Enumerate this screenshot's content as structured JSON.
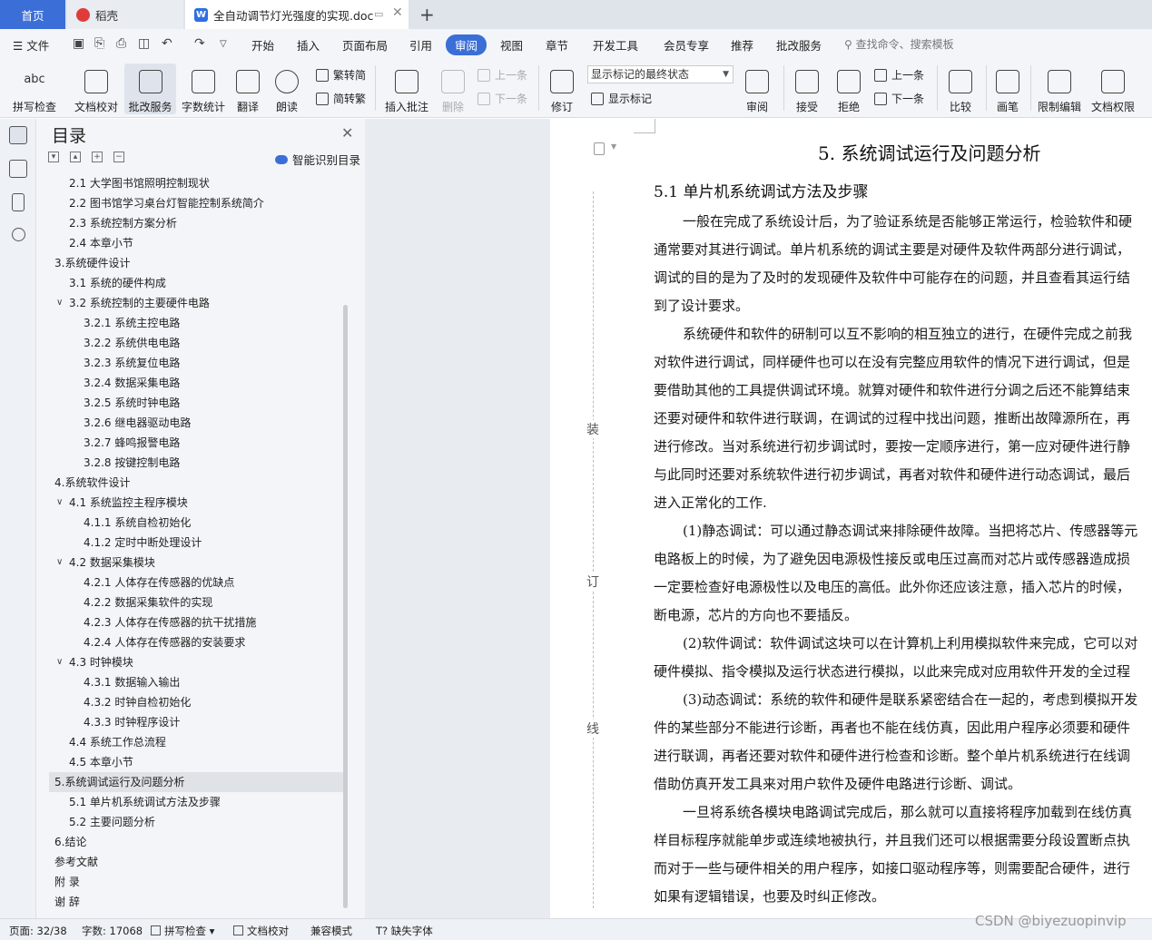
{
  "tabs": {
    "home": "首页",
    "daoke": "稻壳",
    "doc": "全自动调节灯光强度的实现.doc"
  },
  "menu": {
    "file": "文件",
    "items": [
      "开始",
      "插入",
      "页面布局",
      "引用",
      "审阅",
      "视图",
      "章节",
      "开发工具",
      "会员专享",
      "推荐",
      "批改服务"
    ],
    "active": "审阅",
    "search": "查找命令、搜索模板"
  },
  "ribbon": {
    "spell_check": "拼写检查",
    "doc_proof": "文档校对",
    "correction_service": "批改服务",
    "word_count": "字数统计",
    "translate": "翻译",
    "read_aloud": "朗读",
    "trad_to_simp": "繁转简",
    "simp_to_trad": "简转繁",
    "insert_comment": "插入批注",
    "delete": "删除",
    "prev_comment": "上一条",
    "next_comment": "下一条",
    "track_changes": "修订",
    "markup_state": "显示标记的最终状态",
    "show_markup": "显示标记",
    "review": "审阅",
    "accept": "接受",
    "reject": "拒绝",
    "prev": "上一条",
    "next": "下一条",
    "compare": "比较",
    "pen": "画笔",
    "restrict_edit": "限制编辑",
    "doc_permission": "文档权限"
  },
  "toc": {
    "title": "目录",
    "smart": "智能识别目录",
    "items": [
      {
        "text": "2.1  大学图书馆照明控制现状",
        "level": 2
      },
      {
        "text": "2.2  图书馆学习桌台灯智能控制系统简介",
        "level": 2
      },
      {
        "text": "2.3  系统控制方案分析",
        "level": 2
      },
      {
        "text": "2.4  本章小节",
        "level": 2
      },
      {
        "text": "3.系统硬件设计",
        "level": 1,
        "caret": true
      },
      {
        "text": "3.1  系统的硬件构成",
        "level": 2
      },
      {
        "text": "3.2  系统控制的主要硬件电路",
        "level": 2,
        "caret": true
      },
      {
        "text": "3.2.1  系统主控电路",
        "level": 3
      },
      {
        "text": "3.2.2  系统供电电路",
        "level": 3
      },
      {
        "text": "3.2.3  系统复位电路",
        "level": 3
      },
      {
        "text": "3.2.4  数据采集电路",
        "level": 3
      },
      {
        "text": "3.2.5  系统时钟电路",
        "level": 3
      },
      {
        "text": "3.2.6  继电器驱动电路",
        "level": 3
      },
      {
        "text": "3.2.7  蜂鸣报警电路",
        "level": 3
      },
      {
        "text": "3.2.8  按键控制电路",
        "level": 3
      },
      {
        "text": "4.系统软件设计",
        "level": 1,
        "caret": true
      },
      {
        "text": "4.1 系统监控主程序模块",
        "level": 2,
        "caret": true
      },
      {
        "text": "4.1.1  系统自检初始化",
        "level": 3
      },
      {
        "text": "4.1.2  定时中断处理设计",
        "level": 3
      },
      {
        "text": "4.2  数据采集模块",
        "level": 2,
        "caret": true
      },
      {
        "text": "4.2.1  人体存在传感器的优缺点",
        "level": 3
      },
      {
        "text": "4.2.2  数据采集软件的实现",
        "level": 3
      },
      {
        "text": "4.2.3  人体存在传感器的抗干扰措施",
        "level": 3
      },
      {
        "text": "4.2.4  人体存在传感器的安装要求",
        "level": 3
      },
      {
        "text": "4.3  时钟模块",
        "level": 2,
        "caret": true
      },
      {
        "text": "4.3.1  数据输入输出",
        "level": 3
      },
      {
        "text": "4.3.2  时钟自检初始化",
        "level": 3
      },
      {
        "text": "4.3.3  时钟程序设计",
        "level": 3
      },
      {
        "text": "4.4  系统工作总流程",
        "level": 2
      },
      {
        "text": "4.5  本章小节",
        "level": 2
      },
      {
        "text": "5.系统调试运行及问题分析",
        "level": 1,
        "caret": true,
        "selected": true
      },
      {
        "text": "5.1  单片机系统调试方法及步骤",
        "level": 2
      },
      {
        "text": "5.2  主要问题分析",
        "level": 2
      },
      {
        "text": "6.结论",
        "level": 1
      },
      {
        "text": "参考文献",
        "level": 1
      },
      {
        "text": "附    录",
        "level": 1
      },
      {
        "text": "谢    辞",
        "level": 1
      }
    ]
  },
  "document": {
    "binding": [
      "装",
      "订",
      "线"
    ],
    "h1": "5.  系统调试运行及问题分析",
    "h2": "5.1  单片机系统调试方法及步骤",
    "lines": [
      {
        "t": "一般在完成了系统设计后，为了验证系统是否能够正常运行，检验软件和硬",
        "i": true
      },
      {
        "t": "通常要对其进行调试。单片机系统的调试主要是对硬件及软件两部分进行调试，",
        "i": false
      },
      {
        "t": "调试的目的是为了及时的发现硬件及软件中可能存在的问题，并且查看其运行结",
        "i": false
      },
      {
        "t": "到了设计要求。",
        "i": false
      },
      {
        "t": "系统硬件和软件的研制可以互不影响的相互独立的进行，在硬件完成之前我",
        "i": true
      },
      {
        "t": "对软件进行调试，同样硬件也可以在没有完整应用软件的情况下进行调试，但是",
        "i": false
      },
      {
        "t": "要借助其他的工具提供调试环境。就算对硬件和软件进行分调之后还不能算结束",
        "i": false
      },
      {
        "t": "还要对硬件和软件进行联调，在调试的过程中找出问题，推断出故障源所在，再",
        "i": false
      },
      {
        "t": "进行修改。当对系统进行初步调试时，要按一定顺序进行，第一应对硬件进行静",
        "i": false
      },
      {
        "t": "与此同时还要对系统软件进行初步调试，再者对软件和硬件进行动态调试，最后",
        "i": false
      },
      {
        "t": "进入正常化的工作.",
        "i": false
      },
      {
        "t": "(1)静态调试：可以通过静态调试来排除硬件故障。当把将芯片、传感器等元",
        "i": true
      },
      {
        "t": "电路板上的时候，为了避免因电源极性接反或电压过高而对芯片或传感器造成损",
        "i": false
      },
      {
        "t": "一定要检查好电源极性以及电压的高低。此外你还应该注意，插入芯片的时候，",
        "i": false
      },
      {
        "t": "断电源，芯片的方向也不要插反。",
        "i": false
      },
      {
        "t": "(2)软件调试：软件调试这块可以在计算机上利用模拟软件来完成，它可以对",
        "i": true
      },
      {
        "t": "硬件模拟、指令模拟及运行状态进行模拟，以此来完成对应用软件开发的全过程",
        "i": false
      },
      {
        "t": "(3)动态调试：系统的软件和硬件是联系紧密结合在一起的，考虑到模拟开发",
        "i": true
      },
      {
        "t": "件的某些部分不能进行诊断，再者也不能在线仿真，因此用户程序必须要和硬件",
        "i": false
      },
      {
        "t": "进行联调，再者还要对软件和硬件进行检查和诊断。整个单片机系统进行在线调",
        "i": false
      },
      {
        "t": "借助仿真开发工具来对用户软件及硬件电路进行诊断、调试。",
        "i": false
      },
      {
        "t": "一旦将系统各模块电路调试完成后，那么就可以直接将程序加载到在线仿真",
        "i": true
      },
      {
        "t": "样目标程序就能单步或连续地被执行，并且我们还可以根据需要分段设置断点执",
        "i": false
      },
      {
        "t": "而对于一些与硬件相关的用户程序，如接口驱动程序等，则需要配合硬件，进行",
        "i": false
      },
      {
        "t": "如果有逻辑错误，也要及时纠正修改。",
        "i": false
      }
    ]
  },
  "status": {
    "page": "页面: 32/38",
    "words": "字数: 17068",
    "spell": "拼写检查",
    "proof": "文档校对",
    "compat": "兼容模式",
    "missing_font": "缺失字体"
  },
  "watermark": "CSDN @biyezuopinvip"
}
